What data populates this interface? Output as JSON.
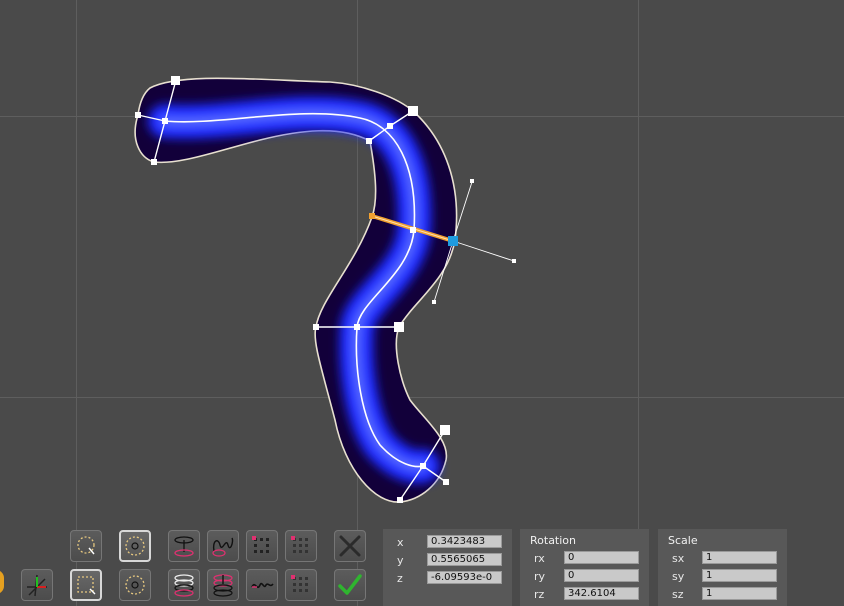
{
  "position": {
    "x_label": "x",
    "x_value": "0.3423483",
    "y_label": "y",
    "y_value": "0.5565065",
    "z_label": "z",
    "z_value": "-6.09593e-0"
  },
  "rotation": {
    "title": "Rotation",
    "rx_label": "rx",
    "rx_value": "0",
    "ry_label": "ry",
    "ry_value": "0",
    "rz_label": "rz",
    "rz_value": "342.6104"
  },
  "scale": {
    "title": "Scale",
    "sx_label": "sx",
    "sx_value": "1",
    "sy_label": "sy",
    "sy_value": "1",
    "sz_label": "sz",
    "sz_value": "1"
  },
  "toolbar": {
    "icons": [
      "lasso-select-icon",
      "axis-gizmo-icon",
      "circle-select-icon",
      "rect-select-icon",
      "circle-edit-icon",
      "dashed-circle-icon",
      "ring-icon",
      "spiral-icon",
      "stacked-rings-icon",
      "spiral-cross-icon",
      "vertex-grid-icon",
      "squiggle-icon",
      "pink-grid-icon",
      "pink-grid-b-icon",
      "cancel-icon",
      "confirm-icon"
    ]
  },
  "colors": {
    "background": "#4a4a4a",
    "grid": "#5c5c5c",
    "tube_core": "#1a2cff",
    "tube_edge": "#14004a",
    "selection_handle": "#1f9be0",
    "selection_edge": "#f0a030",
    "cancel": "#2b2b2b",
    "confirm": "#2fb52f"
  }
}
